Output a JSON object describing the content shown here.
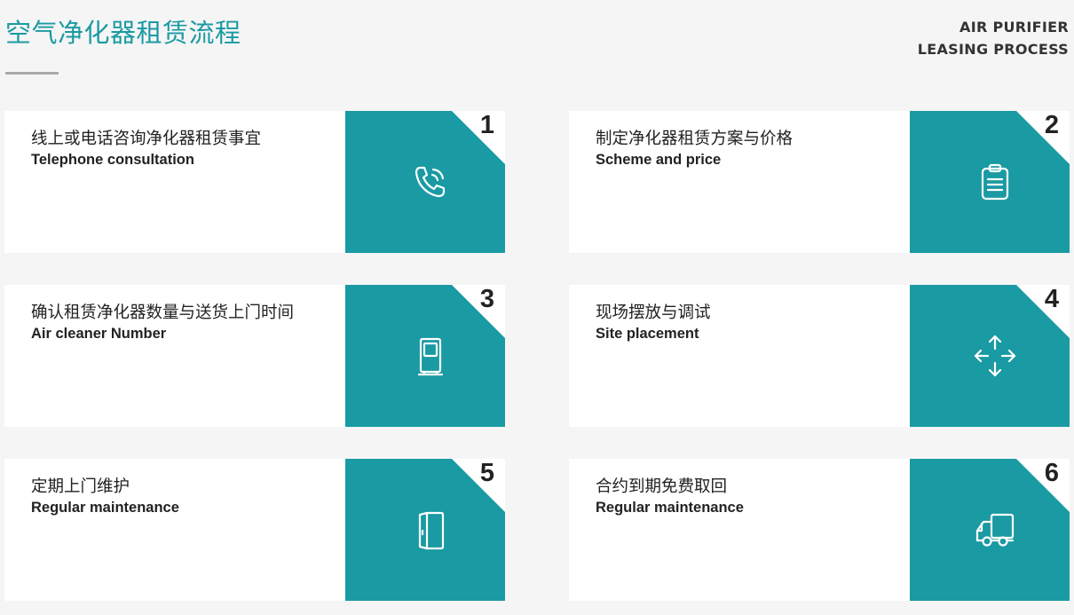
{
  "header": {
    "title": "空气净化器租赁流程",
    "en_line1": "AIR PURIFIER",
    "en_line2": "LEASING PROCESS"
  },
  "colors": {
    "accent": "#1a9aa3",
    "background": "#f5f5f5",
    "card": "#ffffff",
    "text": "#222222",
    "rule": "#a9a9a9"
  },
  "steps": [
    {
      "num": "1",
      "zh": "线上或电话咨询净化器租赁事宜",
      "en": "Telephone consultation",
      "icon": "phone-icon"
    },
    {
      "num": "2",
      "zh": "制定净化器租赁方案与价格",
      "en": "Scheme and price",
      "icon": "clipboard-icon"
    },
    {
      "num": "3",
      "zh": "确认租赁净化器数量与送货上门时间",
      "en": "Air cleaner Number",
      "icon": "air-purifier-icon"
    },
    {
      "num": "4",
      "zh": "现场摆放与调试",
      "en": "Site placement",
      "icon": "move-arrows-icon"
    },
    {
      "num": "5",
      "zh": "定期上门维护",
      "en": "Regular maintenance",
      "icon": "door-icon"
    },
    {
      "num": "6",
      "zh": "合约到期免费取回",
      "en": "Regular maintenance",
      "icon": "truck-icon"
    }
  ]
}
